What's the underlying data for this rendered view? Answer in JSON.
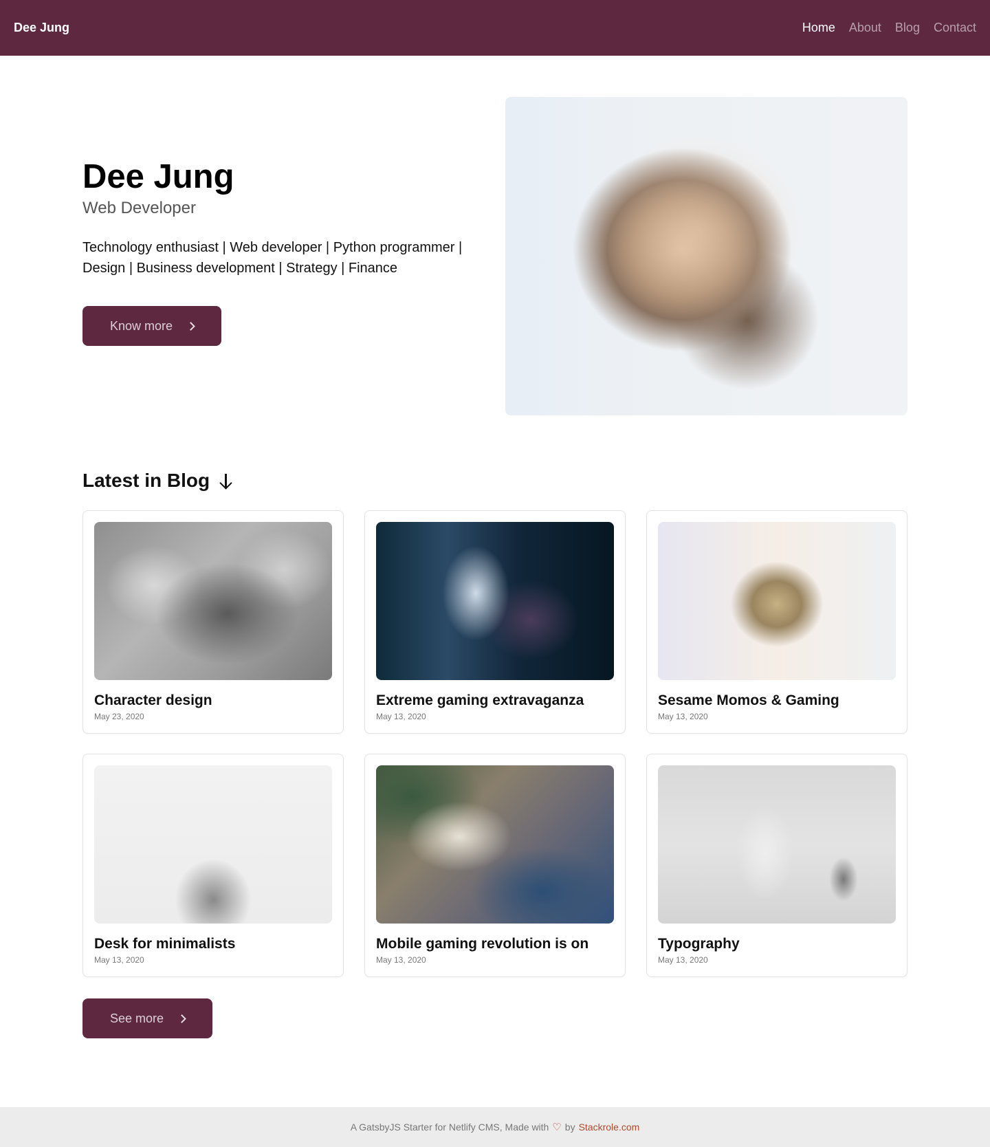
{
  "header": {
    "brand": "Dee Jung",
    "nav": [
      {
        "label": "Home",
        "active": true
      },
      {
        "label": "About",
        "active": false
      },
      {
        "label": "Blog",
        "active": false
      },
      {
        "label": "Contact",
        "active": false
      }
    ]
  },
  "hero": {
    "name": "Dee Jung",
    "role": "Web Developer",
    "bio": "Technology enthusiast | Web developer | Python programmer | Design | Business development | Strategy | Finance",
    "button_label": "Know more"
  },
  "blog": {
    "title": "Latest in Blog",
    "posts": [
      {
        "title": "Character design",
        "date": "May 23, 2020"
      },
      {
        "title": "Extreme gaming extravaganza",
        "date": "May 13, 2020"
      },
      {
        "title": "Sesame Momos & Gaming",
        "date": "May 13, 2020"
      },
      {
        "title": "Desk for minimalists",
        "date": "May 13, 2020"
      },
      {
        "title": "Mobile gaming revolution is on",
        "date": "May 13, 2020"
      },
      {
        "title": "Typography",
        "date": "May 13, 2020"
      }
    ],
    "see_more_label": "See more"
  },
  "footer": {
    "text": "A GatsbyJS Starter for Netlify CMS, Made with",
    "heart": "♡",
    "by": "by",
    "link": "Stackrole.com"
  },
  "colors": {
    "brand": "#5e2841",
    "footer_bg": "#ececec",
    "link": "#b04a2b"
  },
  "icons": [
    "chevron-right-icon",
    "arrow-down-icon",
    "heart-icon"
  ]
}
